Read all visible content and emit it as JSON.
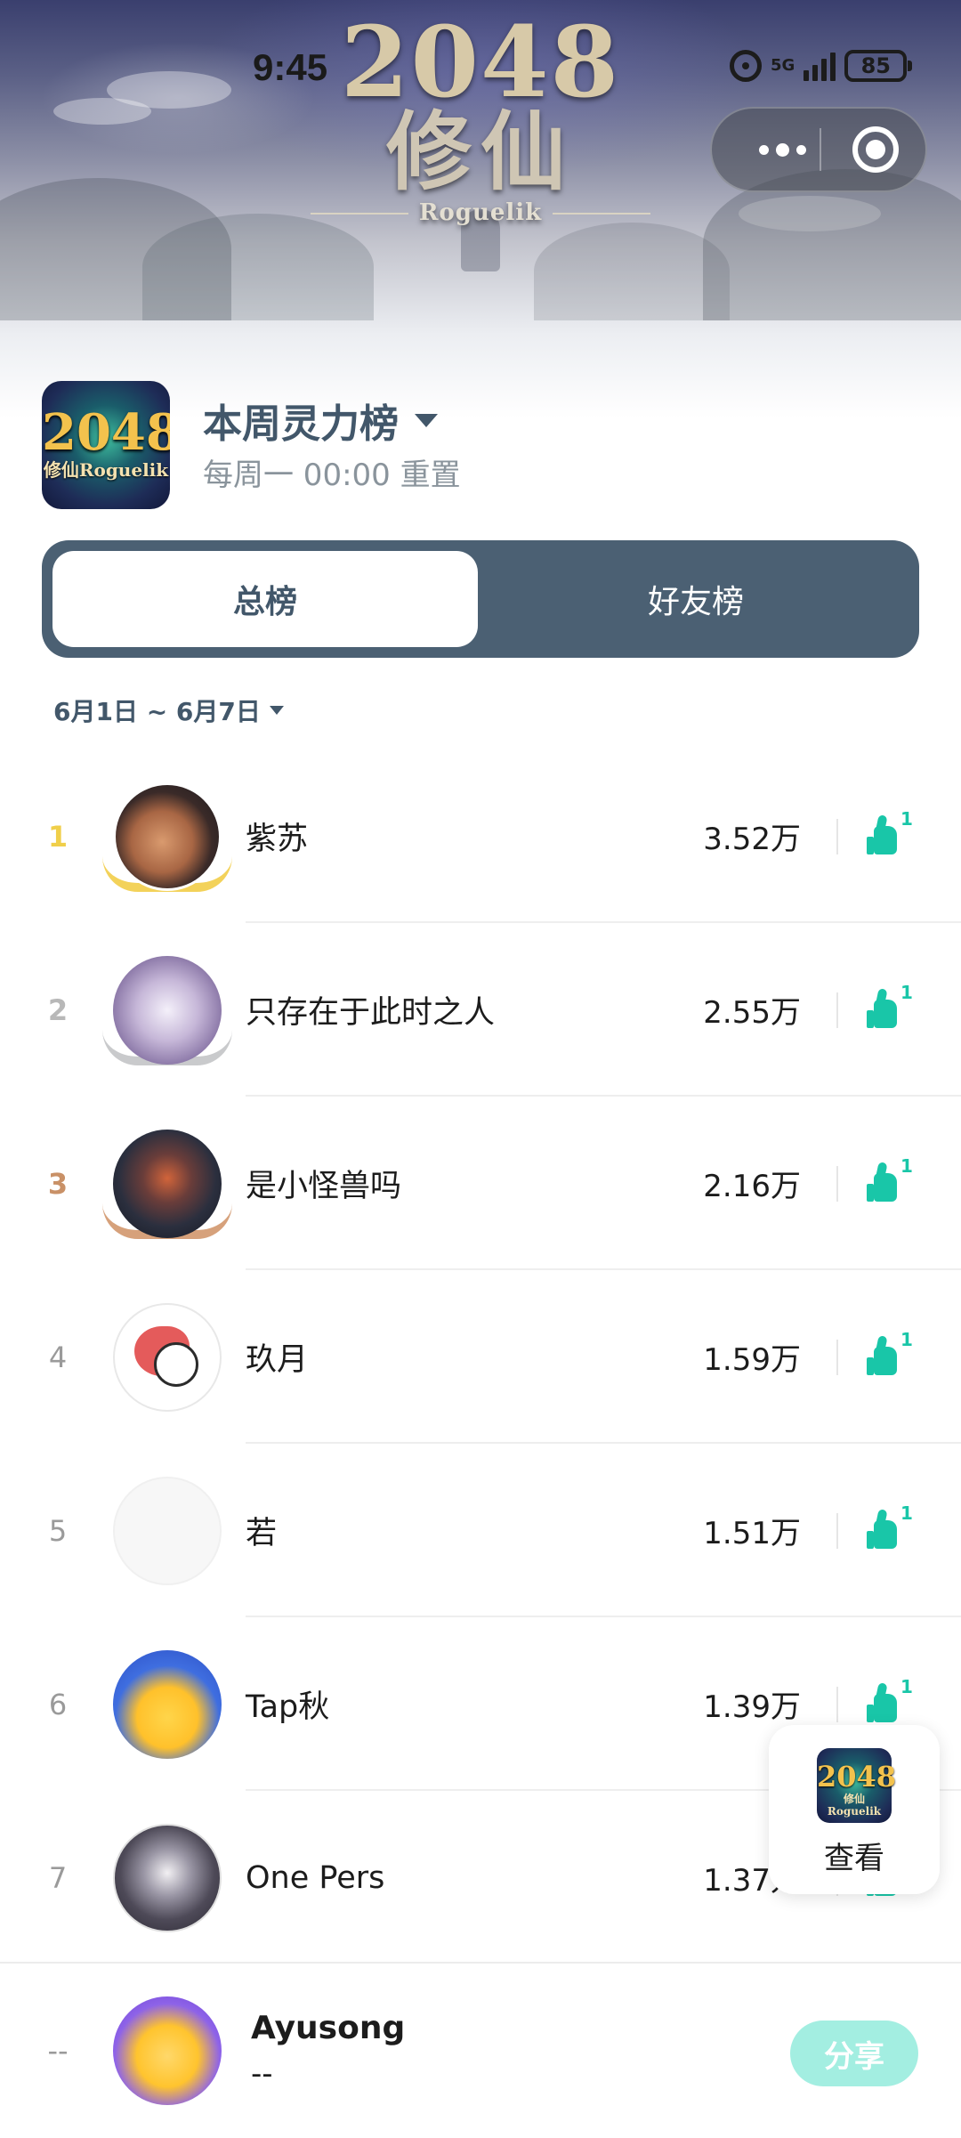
{
  "status_bar": {
    "time": "9:45",
    "network": "5G",
    "battery": "85"
  },
  "banner": {
    "title_number": "2048",
    "title_cn": "修仙",
    "subtitle": "Roguelik"
  },
  "app_icon": {
    "number": "2048",
    "sub": "修仙Roguelik"
  },
  "header": {
    "title": "本周灵力榜",
    "reset_note": "每周一 00:00 重置"
  },
  "tabs": [
    {
      "label": "总榜",
      "selected": true
    },
    {
      "label": "好友榜",
      "selected": false
    }
  ],
  "date_range": "6月1日 ~ 6月7日",
  "ranking": [
    {
      "rank": "1",
      "name": "紫苏",
      "score": "3.52万",
      "likes": "1",
      "medal": "gold"
    },
    {
      "rank": "2",
      "name": "只存在于此时之人",
      "score": "2.55万",
      "likes": "1",
      "medal": "silver"
    },
    {
      "rank": "3",
      "name": "是小怪兽吗",
      "score": "2.16万",
      "likes": "1",
      "medal": "bronze"
    },
    {
      "rank": "4",
      "name": "玖月",
      "score": "1.59万",
      "likes": "1"
    },
    {
      "rank": "5",
      "name": "若",
      "score": "1.51万",
      "likes": "1"
    },
    {
      "rank": "6",
      "name": "Tap秋",
      "score": "1.39万",
      "likes": "1"
    },
    {
      "rank": "7",
      "name": "One Pers",
      "score": "1.37万",
      "likes": "1"
    }
  ],
  "view_card": {
    "label": "查看",
    "icon_number": "2048",
    "icon_sub": "修仙Roguelik"
  },
  "me": {
    "rank": "--",
    "name": "Ayusong",
    "score": "--",
    "share_label": "分享"
  },
  "colors": {
    "accent": "#19c6a8",
    "tab_bg": "#4b6073",
    "title": "#42576a",
    "gold": "#f0cf4a",
    "silver": "#b8b8b8",
    "bronze": "#c99167"
  }
}
